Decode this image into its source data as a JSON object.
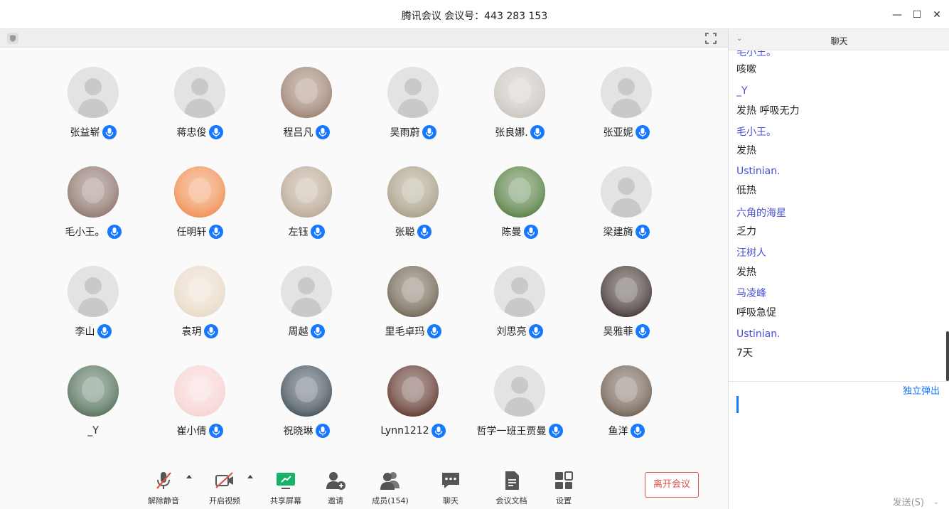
{
  "window": {
    "title": "腾讯会议 会议号：443 283 153",
    "minimize": "—",
    "maximize": "☐",
    "close": "✕"
  },
  "participants": [
    {
      "name": "张益崭",
      "avatar": "default"
    },
    {
      "name": "蒋忠俊",
      "avatar": "default"
    },
    {
      "name": "程吕凡",
      "avatar": "photo-baby",
      "color": "#9a7c6b"
    },
    {
      "name": "吴雨蔚",
      "avatar": "default"
    },
    {
      "name": "张良娜.",
      "avatar": "photo-cat",
      "color": "#c9c3bd"
    },
    {
      "name": "张亚妮",
      "avatar": "default"
    },
    {
      "name": "毛小王。",
      "avatar": "photo-girl",
      "color": "#8a6f66"
    },
    {
      "name": "任明轩",
      "avatar": "cartoon-dog",
      "color": "#f08a4b"
    },
    {
      "name": "左钰",
      "avatar": "photo-cat2",
      "color": "#b7a590"
    },
    {
      "name": "张聪",
      "avatar": "photo-painting",
      "color": "#a59b82"
    },
    {
      "name": "陈曼",
      "avatar": "photo-dog",
      "color": "#4f7a3a"
    },
    {
      "name": "梁建旖",
      "avatar": "default"
    },
    {
      "name": "李山",
      "avatar": "default"
    },
    {
      "name": "袁玥",
      "avatar": "photo-puppy",
      "color": "#e8d8c4"
    },
    {
      "name": "周越",
      "avatar": "default"
    },
    {
      "name": "里毛卓玛",
      "avatar": "photo-street",
      "color": "#6b5e4c"
    },
    {
      "name": "刘思亮",
      "avatar": "default"
    },
    {
      "name": "吴雅菲",
      "avatar": "photo-kid",
      "color": "#3b2e2a"
    },
    {
      "name": "_Y",
      "avatar": "photo-woman",
      "color": "#4e6b53",
      "no_mic": true
    },
    {
      "name": "崔小倩",
      "avatar": "cartoon-red",
      "color": "#f6d1d0"
    },
    {
      "name": "祝晓琳",
      "avatar": "photo-toy",
      "color": "#3d4b56"
    },
    {
      "name": "Lynn1212",
      "avatar": "photo-cafe",
      "color": "#5a2e25"
    },
    {
      "name": "哲学一班王贾曼",
      "avatar": "default"
    },
    {
      "name": "鱼洋",
      "avatar": "photo-girl2",
      "color": "#6c5a4c"
    }
  ],
  "toolbar": {
    "unmute": "解除静音",
    "video": "开启视频",
    "share": "共享屏幕",
    "invite": "邀请",
    "members": "成员(154)",
    "chat": "聊天",
    "docs": "会议文档",
    "settings": "设置",
    "leave": "离开会议"
  },
  "chat": {
    "title": "聊天",
    "messages": [
      {
        "sender": "毛小王。",
        "text": "咳嗽"
      },
      {
        "sender": "_Y",
        "text": "发热 呼吸无力"
      },
      {
        "sender": "毛小王。",
        "text": "发热"
      },
      {
        "sender": "Ustinian.",
        "text": "低热"
      },
      {
        "sender": "六角的海星",
        "text": "乏力"
      },
      {
        "sender": "汪树人",
        "text": "发热"
      },
      {
        "sender": "马凌峰",
        "text": "呼吸急促"
      },
      {
        "sender": "Ustinian.",
        "text": "7天"
      }
    ],
    "popout": "独立弹出",
    "send": "发送(S)"
  },
  "colors": {
    "accent": "#1677ff",
    "sender": "#4a4fd6",
    "leave": "#e0524a",
    "share_green": "#17b26a"
  }
}
